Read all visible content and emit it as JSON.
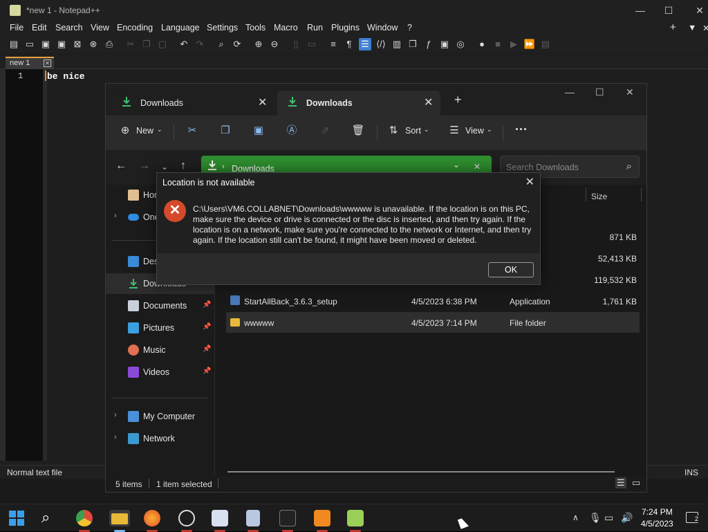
{
  "notepad": {
    "title": "*new 1 - Notepad++",
    "menu": [
      "File",
      "Edit",
      "Search",
      "View",
      "Encoding",
      "Language",
      "Settings",
      "Tools",
      "Macro",
      "Run",
      "Plugins",
      "Window",
      "?"
    ],
    "tab_label": "new 1",
    "line_number": "1",
    "line_text": "be nice",
    "status_left": "Normal text file",
    "status_right": "INS"
  },
  "explorer": {
    "tabs": [
      {
        "label": "Downloads"
      },
      {
        "label": "Downloads"
      }
    ],
    "toolbar": {
      "new_label": "New",
      "sort_label": "Sort",
      "view_label": "View",
      "more_label": "···"
    },
    "address": "Downloads",
    "search_placeholder": "Search Downloads",
    "nav": [
      {
        "label": "Home"
      },
      {
        "label": "OneDrive"
      },
      {
        "label": "Desktop"
      },
      {
        "label": "Downloads"
      },
      {
        "label": "Documents"
      },
      {
        "label": "Pictures"
      },
      {
        "label": "Music"
      },
      {
        "label": "Videos"
      },
      {
        "label": "My Computer"
      },
      {
        "label": "Network"
      }
    ],
    "columns": {
      "size": "Size"
    },
    "rows": [
      {
        "name": "",
        "date": "",
        "type": "e",
        "size": "871 KB"
      },
      {
        "name": "",
        "date": "",
        "type": "on",
        "size": "52,413 KB"
      },
      {
        "name": "",
        "date": "",
        "type": "on",
        "size": "119,532 KB"
      },
      {
        "name": "StartAllBack_3.6.3_setup",
        "date": "4/5/2023 6:38 PM",
        "type": "Application",
        "size": "1,761 KB"
      },
      {
        "name": "wwwww",
        "date": "4/5/2023 7:14 PM",
        "type": "File folder",
        "size": ""
      }
    ],
    "status": {
      "items": "5 items",
      "selected": "1 item selected"
    }
  },
  "dialog": {
    "title": "Location is not available",
    "message": "C:\\Users\\VM6.COLLABNET\\Downloads\\wwwww is unavailable. If the location is on this PC, make sure the device or drive is connected or the disc is inserted, and then try again. If the location is on a network, make sure you're connected to the network or Internet, and then try again. If the location still can't be found, it might have been moved or deleted.",
    "ok_label": "OK",
    "icon": "error-icon",
    "accent": "#d44a2a"
  },
  "taskbar": {
    "time": "7:24 PM",
    "date": "4/5/2023",
    "notification_count": "2"
  }
}
